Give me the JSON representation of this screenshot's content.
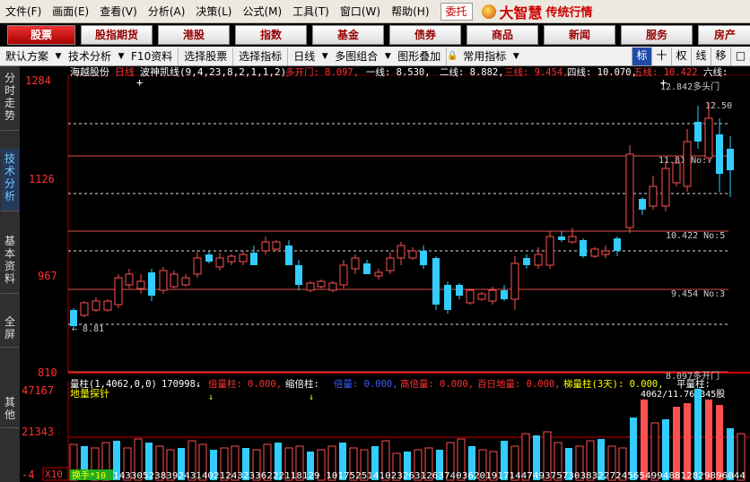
{
  "menu": [
    "文件(F)",
    "画面(E)",
    "查看(V)",
    "分析(A)",
    "决策(L)",
    "公式(M)",
    "工具(T)",
    "窗口(W)",
    "帮助(H)"
  ],
  "entrust_label": "委托",
  "brand": {
    "name": "大智慧",
    "sub": "传统行情"
  },
  "market_tabs": [
    "股票",
    "股指期货",
    "港股",
    "指数",
    "基金",
    "债券",
    "商品",
    "新闻",
    "服务",
    "房产"
  ],
  "tools": [
    "默认方案",
    "技术分析",
    "F10资料",
    "选择股票",
    "选择指标",
    "日线",
    "多图组合",
    "图形叠加",
    "常用指标"
  ],
  "toolbar_buttons": [
    "标",
    "十",
    "权",
    "线",
    "移",
    "□"
  ],
  "side_tabs": [
    "分时走势",
    "技术分析",
    "基本资料",
    "全屏",
    "其他"
  ],
  "chart": {
    "stock_name": "海越股份",
    "period": "日线",
    "indicator": "波神凯线(9,4,23,8,2,1,1,2)",
    "lines_header": [
      {
        "label": "多开门: 8.097,",
        "color": "#ff3030"
      },
      {
        "label": "一线: 8.530,",
        "color": "#ffffff"
      },
      {
        "label": "二线: 8.882,",
        "color": "#ffffff"
      },
      {
        "label": "三线: 9.454,",
        "color": "#ff3030"
      },
      {
        "label": "四线: 10.070,",
        "color": "#ffffff"
      },
      {
        "label": "五线: 10.422",
        "color": "#ff3030"
      },
      {
        "label": "六线:",
        "color": "#ffffff"
      }
    ],
    "y_ticks": [
      "1284",
      "1126",
      "967",
      "810"
    ],
    "level_labels": [
      "12.842多头门",
      "12.50",
      "11.81 No:7",
      "10.422 No:5",
      "9.454 No:3",
      "8.097多开门"
    ],
    "low_label": "← 8.81"
  },
  "volume": {
    "header": [
      {
        "label": "量柱(1,4062,0,0)",
        "color": "#ffffff"
      },
      {
        "label": "170998↓",
        "color": "#ffffff"
      },
      {
        "label": "倍量柱: 0.000,",
        "color": "#ff3030"
      },
      {
        "label": "缩倍柱:",
        "color": "#ffffff"
      },
      {
        "label": "倍量: 0.000,",
        "color": "#3a5cff"
      },
      {
        "label": "高倍量: 0.000,",
        "color": "#ff3030"
      },
      {
        "label": "百日地量: 0.000,",
        "color": "#ff3030"
      },
      {
        "label": "梯量柱(3天): 0.000,",
        "color": "#ffff00"
      },
      {
        "label": "平量柱:",
        "color": "#ffffff"
      }
    ],
    "sub_label": "地量探针",
    "right_label": "4062/11.76=345股",
    "y_ticks": [
      "47167",
      "21343",
      "-4"
    ],
    "bottom_prefix": "X10",
    "hand_label": "换手*10",
    "bottom_digits": "14330523839243140212432336222118129 10175251410232631263740362019171447493757303832272456549948812829896044"
  }
}
